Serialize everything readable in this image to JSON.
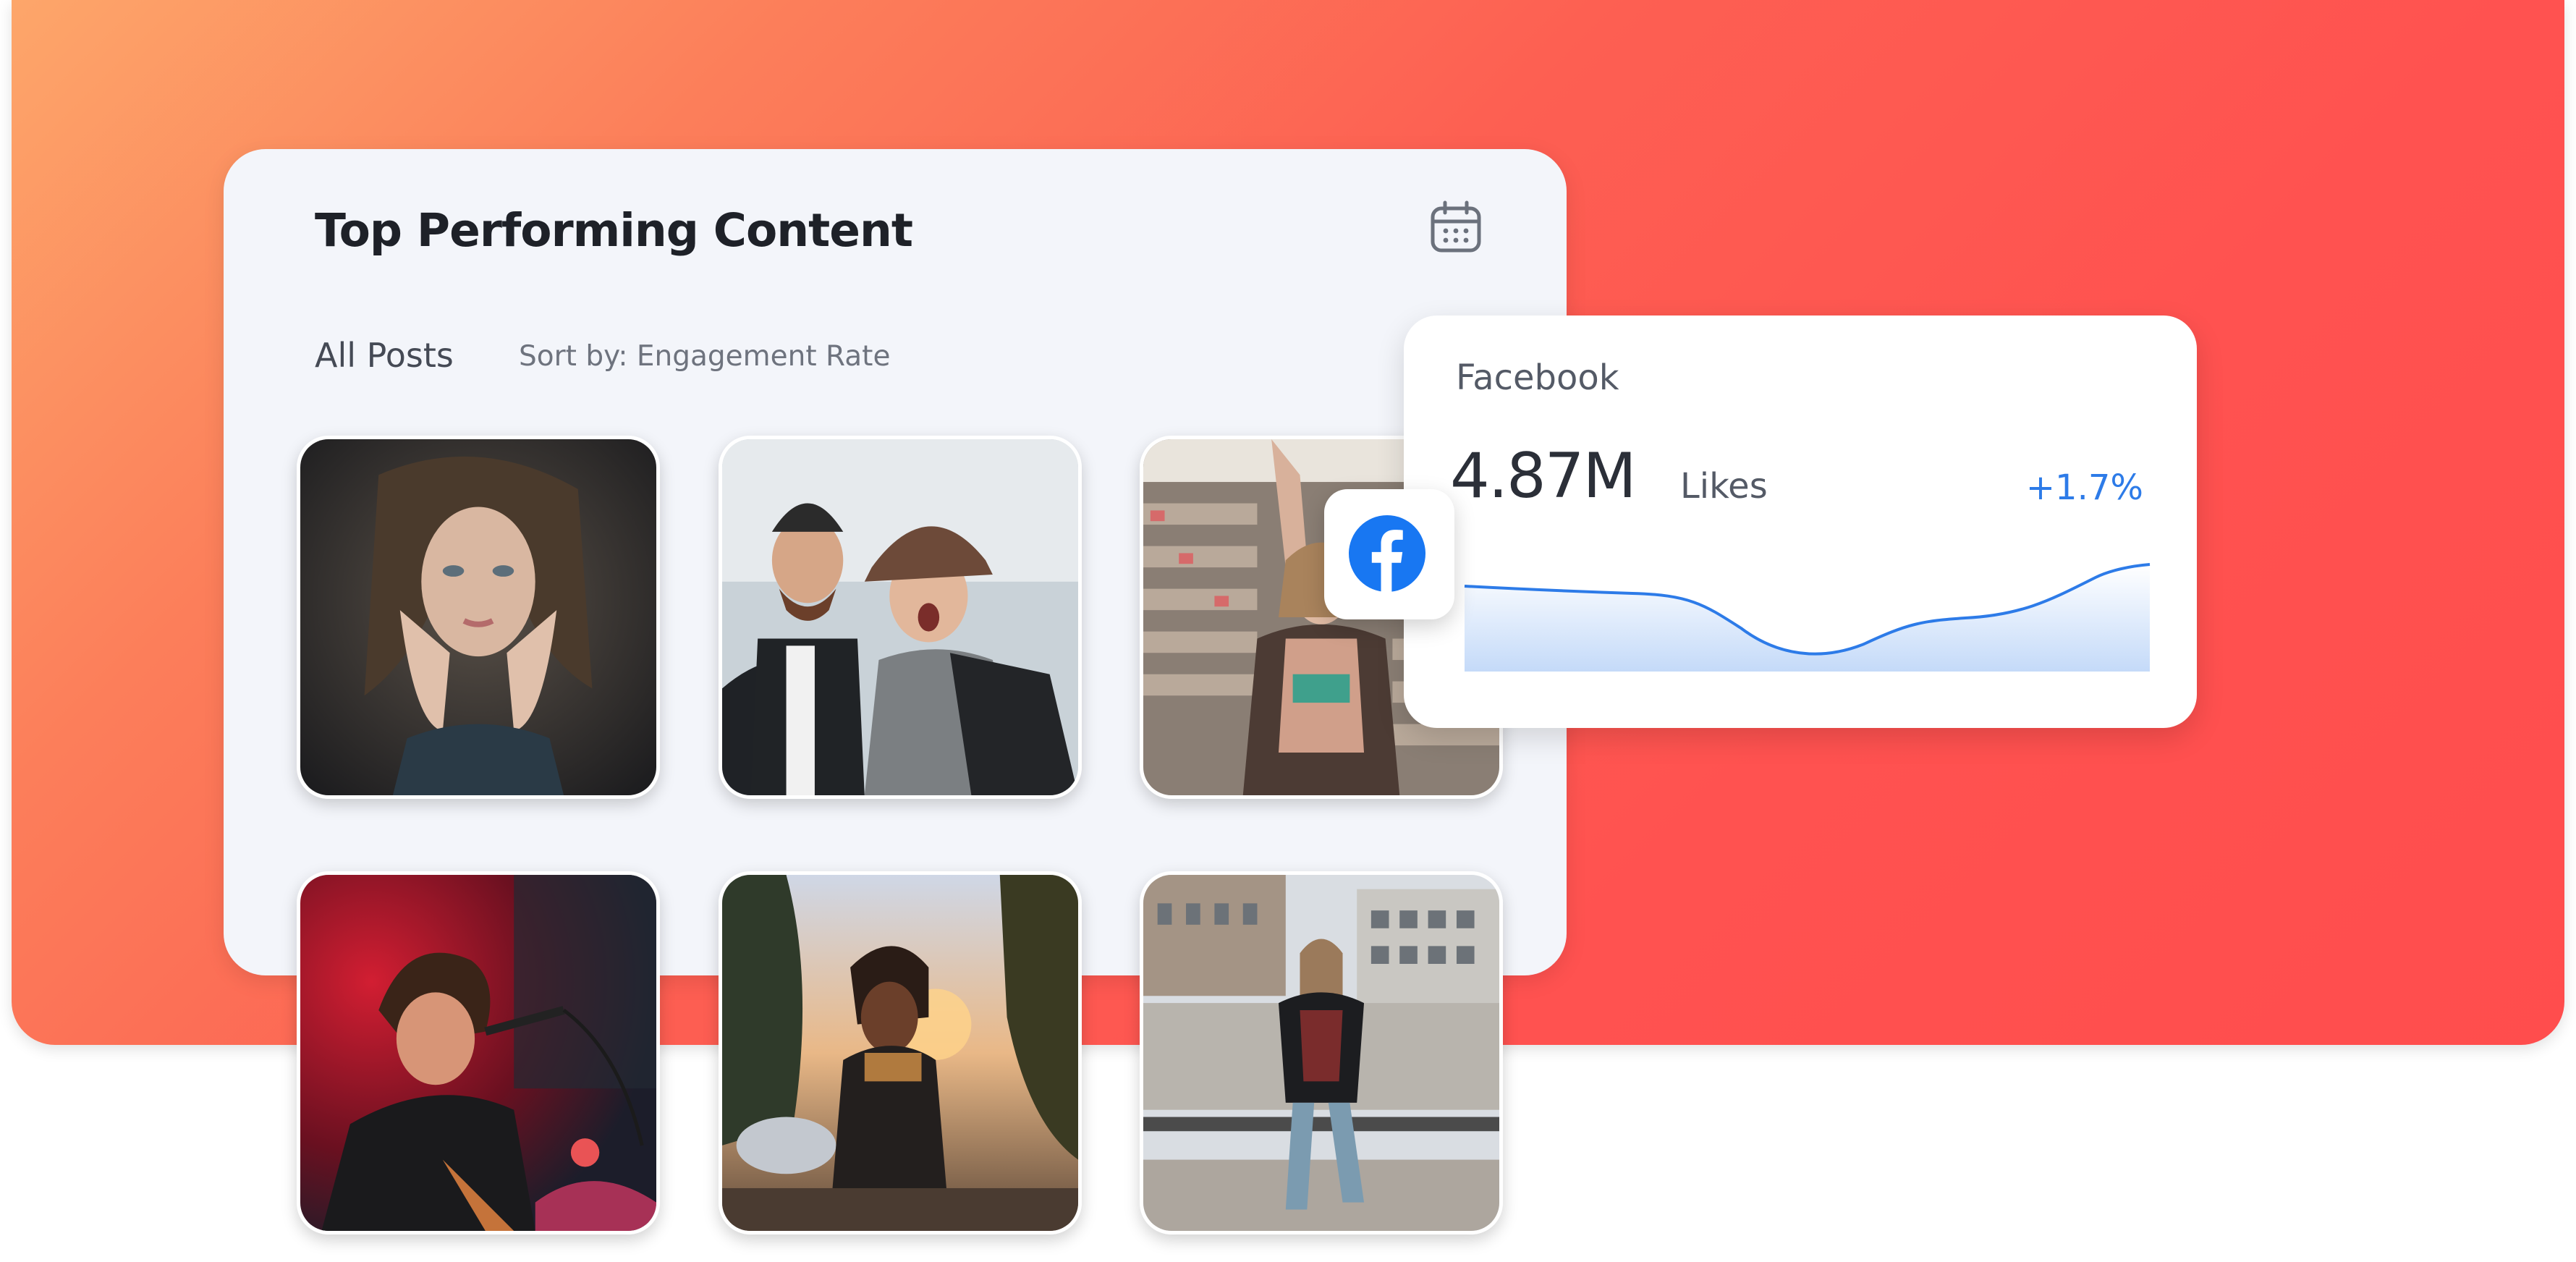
{
  "card": {
    "title": "Top Performing Content",
    "calendar_icon": "calendar-icon",
    "tab_label": "All Posts",
    "sort_label": "Sort by: Engagement Rate"
  },
  "posts": [
    {
      "image": "woman-hands-on-face-photo"
    },
    {
      "image": "two-friends-beanies-photo"
    },
    {
      "image": "woman-in-store-photo"
    },
    {
      "image": "singer-on-stage-photo"
    },
    {
      "image": "man-at-sunset-photo"
    },
    {
      "image": "woman-on-rooftop-photo"
    }
  ],
  "facebook": {
    "platform": "Facebook",
    "value": "4.87M",
    "unit": "Likes",
    "change": "+1.7%",
    "logo_icon": "facebook-logo-icon",
    "accent": "#1877f2",
    "line_color": "#2d7be8"
  },
  "colors": {
    "gradient_start": "#fda66a",
    "gradient_end": "#ff4d4d",
    "card_bg": "#f3f5fa"
  }
}
